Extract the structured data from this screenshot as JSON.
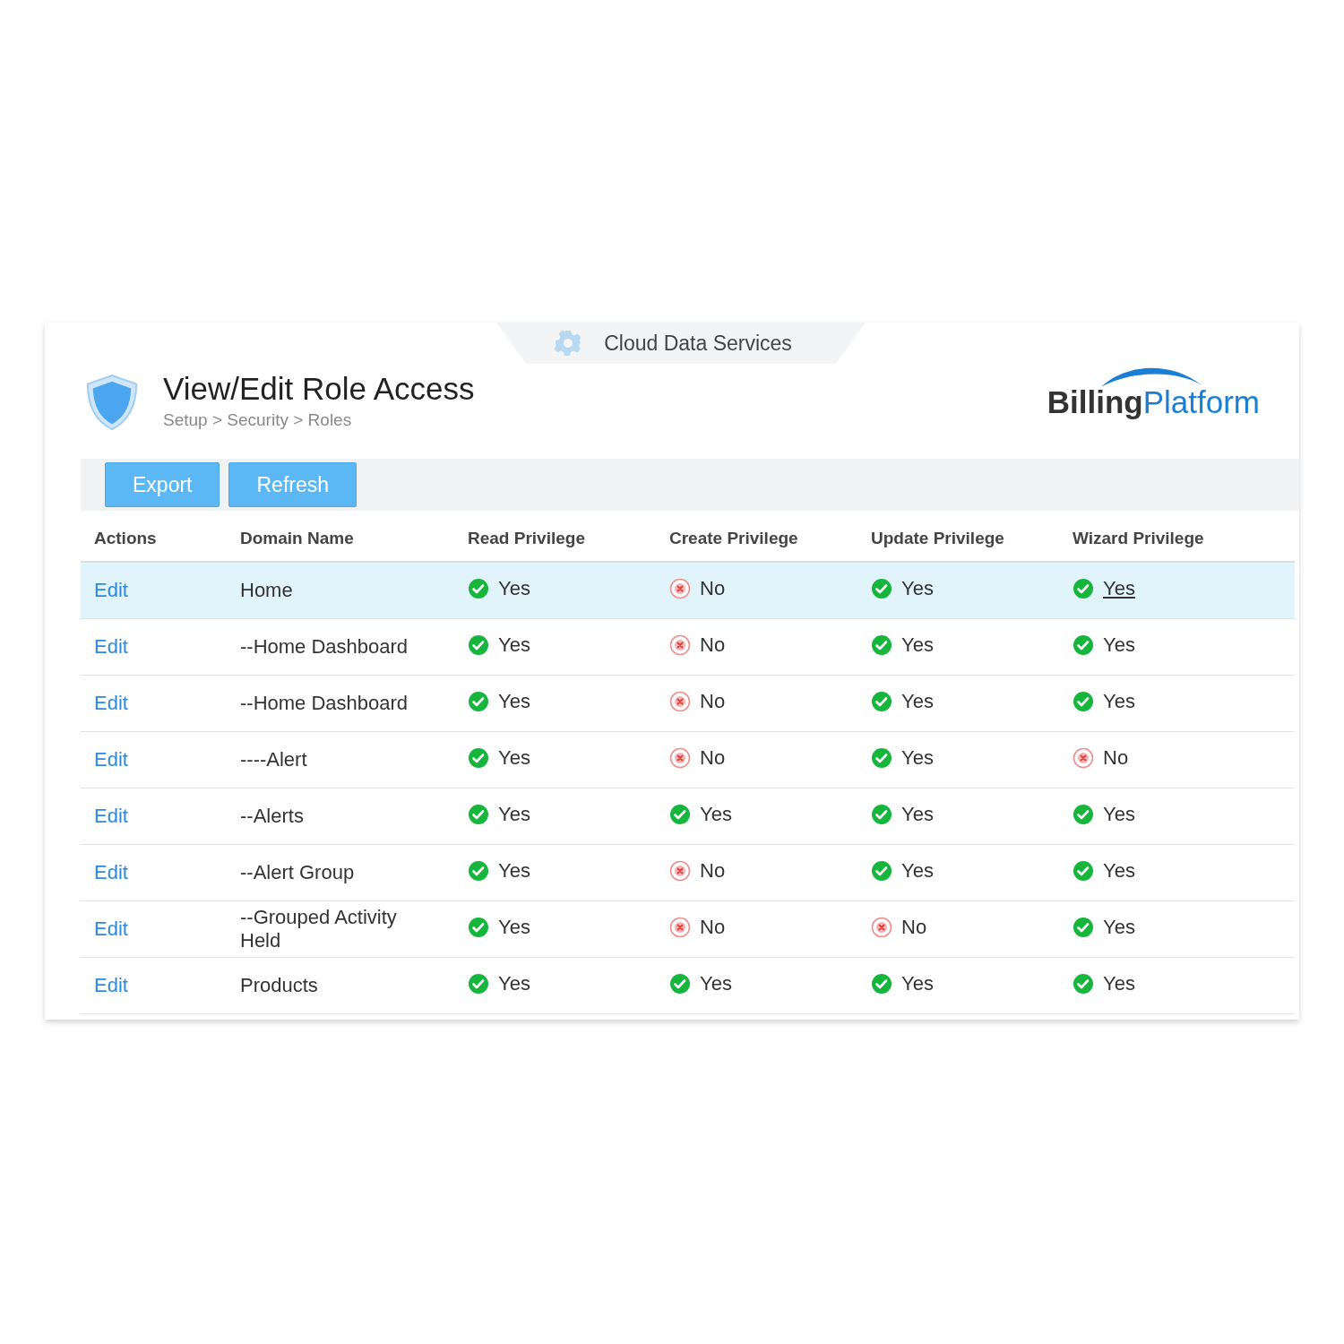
{
  "top_tab": {
    "label": "Cloud Data Services"
  },
  "header": {
    "title": "View/Edit Role Access",
    "breadcrumb": "Setup > Security > Roles"
  },
  "logo": {
    "part_1": "Billing",
    "part_2": "Platform"
  },
  "toolbar": {
    "buttons": [
      "Export",
      "Refresh"
    ]
  },
  "table": {
    "columns": [
      "Actions",
      "Domain Name",
      "Read Privilege",
      "Create Privilege",
      "Update Privilege",
      "Wizard Privilege"
    ],
    "rows": [
      {
        "action": "Edit",
        "domain": "Home",
        "selected": true,
        "privileges": [
          {
            "text": "Yes",
            "granted": true,
            "underlined": false
          },
          {
            "text": "No",
            "granted": false,
            "underlined": false
          },
          {
            "text": "Yes",
            "granted": true,
            "underlined": false
          },
          {
            "text": "Yes",
            "granted": true,
            "underlined": true
          }
        ]
      },
      {
        "action": "Edit",
        "domain": "--Home Dashboard",
        "selected": false,
        "privileges": [
          {
            "text": "Yes",
            "granted": true,
            "underlined": false
          },
          {
            "text": "No",
            "granted": false,
            "underlined": false
          },
          {
            "text": "Yes",
            "granted": true,
            "underlined": false
          },
          {
            "text": "Yes",
            "granted": true,
            "underlined": false
          }
        ]
      },
      {
        "action": "Edit",
        "domain": "--Home Dashboard",
        "selected": false,
        "privileges": [
          {
            "text": "Yes",
            "granted": true,
            "underlined": false
          },
          {
            "text": "No",
            "granted": false,
            "underlined": false
          },
          {
            "text": "Yes",
            "granted": true,
            "underlined": false
          },
          {
            "text": "Yes",
            "granted": true,
            "underlined": false
          }
        ]
      },
      {
        "action": "Edit",
        "domain": "----Alert",
        "selected": false,
        "privileges": [
          {
            "text": "Yes",
            "granted": true,
            "underlined": false
          },
          {
            "text": "No",
            "granted": false,
            "underlined": false
          },
          {
            "text": "Yes",
            "granted": true,
            "underlined": false
          },
          {
            "text": "No",
            "granted": false,
            "underlined": false
          }
        ]
      },
      {
        "action": "Edit",
        "domain": "--Alerts",
        "selected": false,
        "privileges": [
          {
            "text": "Yes",
            "granted": true,
            "underlined": false
          },
          {
            "text": "Yes",
            "granted": true,
            "underlined": false
          },
          {
            "text": "Yes",
            "granted": true,
            "underlined": false
          },
          {
            "text": "Yes",
            "granted": true,
            "underlined": false
          }
        ]
      },
      {
        "action": "Edit",
        "domain": "--Alert Group",
        "selected": false,
        "privileges": [
          {
            "text": "Yes",
            "granted": true,
            "underlined": false
          },
          {
            "text": "No",
            "granted": false,
            "underlined": false
          },
          {
            "text": "Yes",
            "granted": true,
            "underlined": false
          },
          {
            "text": "Yes",
            "granted": true,
            "underlined": false
          }
        ]
      },
      {
        "action": "Edit",
        "domain": "--Grouped Activity Held",
        "selected": false,
        "privileges": [
          {
            "text": "Yes",
            "granted": true,
            "underlined": false
          },
          {
            "text": "No",
            "granted": false,
            "underlined": false
          },
          {
            "text": "No",
            "granted": false,
            "underlined": false
          },
          {
            "text": "Yes",
            "granted": true,
            "underlined": false
          }
        ]
      },
      {
        "action": "Edit",
        "domain": "Products",
        "selected": false,
        "privileges": [
          {
            "text": "Yes",
            "granted": true,
            "underlined": false
          },
          {
            "text": "Yes",
            "granted": true,
            "underlined": false
          },
          {
            "text": "Yes",
            "granted": true,
            "underlined": false
          },
          {
            "text": "Yes",
            "granted": true,
            "underlined": false
          }
        ]
      }
    ]
  }
}
